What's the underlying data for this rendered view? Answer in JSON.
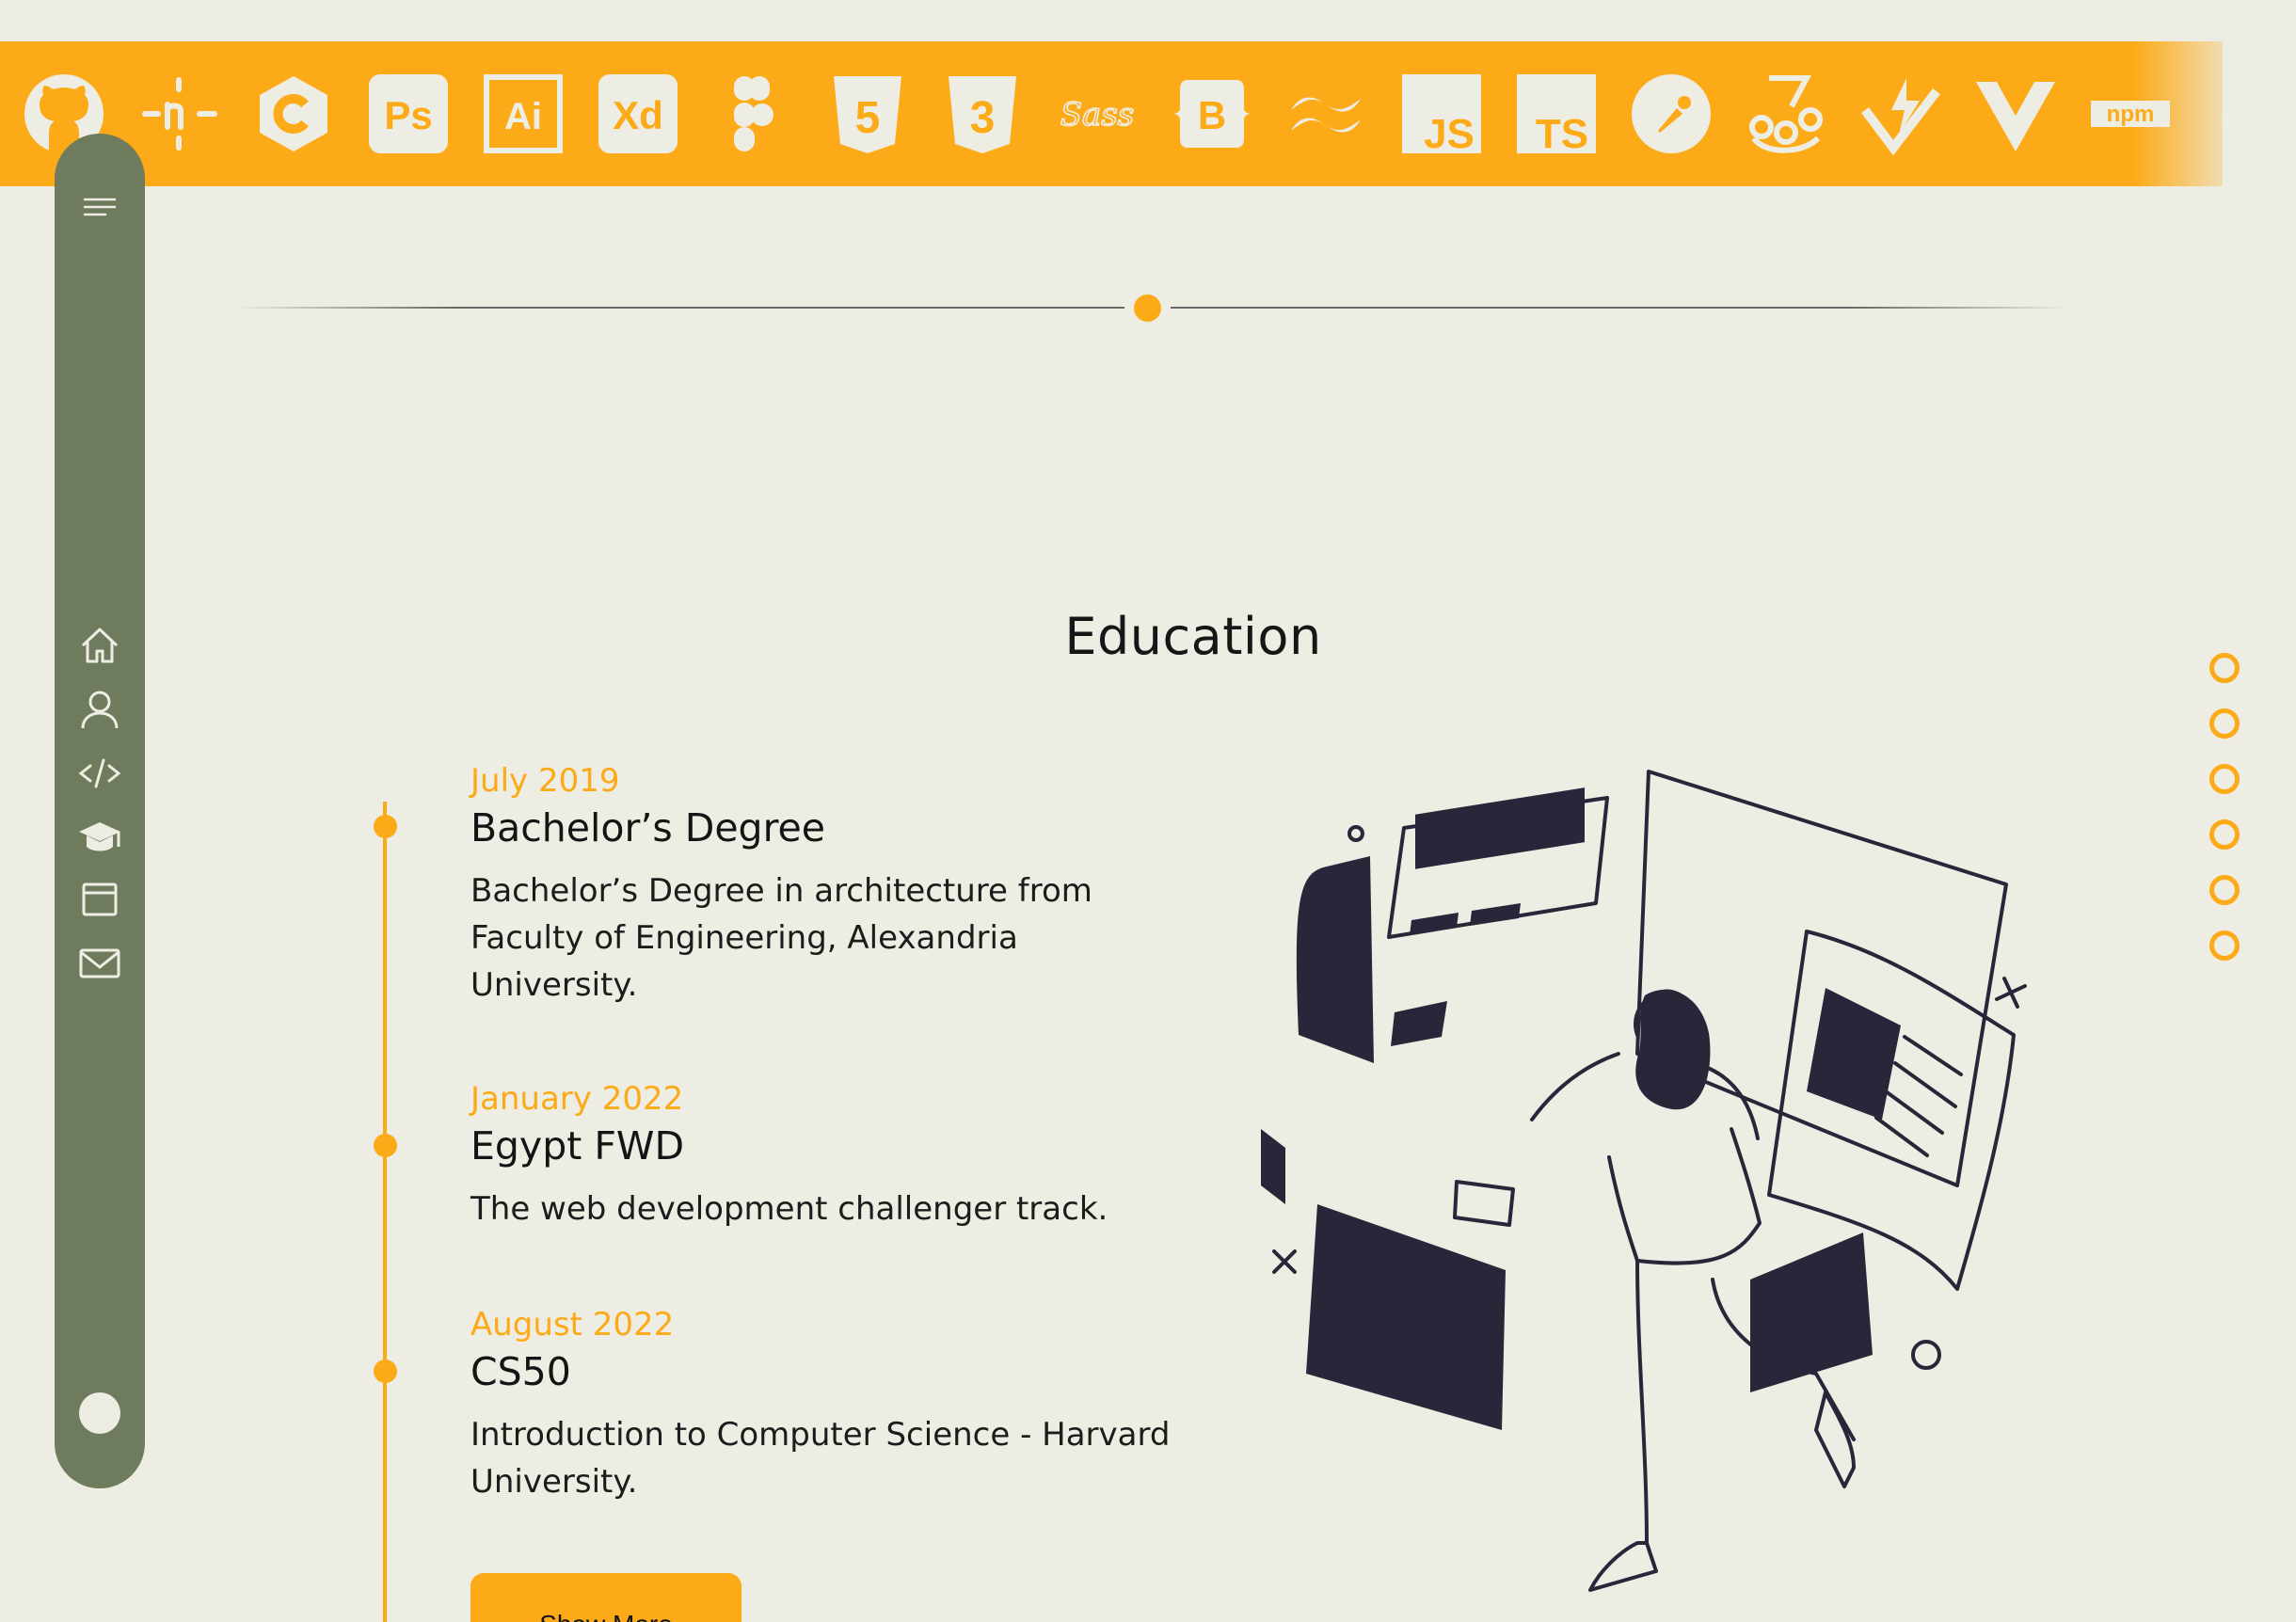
{
  "skills": [
    {
      "name": "github-icon"
    },
    {
      "name": "n8n-icon"
    },
    {
      "name": "c-language-icon"
    },
    {
      "name": "photoshop-icon",
      "label": "Ps"
    },
    {
      "name": "illustrator-icon",
      "label": "Ai"
    },
    {
      "name": "adobe-xd-icon",
      "label": "Xd"
    },
    {
      "name": "figma-icon"
    },
    {
      "name": "html5-icon",
      "label": "5"
    },
    {
      "name": "css3-icon",
      "label": "3"
    },
    {
      "name": "sass-icon",
      "label": "Sass"
    },
    {
      "name": "bootstrap-icon",
      "label": "B"
    },
    {
      "name": "tailwind-icon"
    },
    {
      "name": "javascript-icon",
      "label": "JS"
    },
    {
      "name": "typescript-icon",
      "label": "TS"
    },
    {
      "name": "postman-icon"
    },
    {
      "name": "jest-icon"
    },
    {
      "name": "vitest-icon"
    },
    {
      "name": "vue-icon"
    },
    {
      "name": "npm-icon",
      "label": "npm"
    }
  ],
  "sidebar": {
    "items": [
      {
        "name": "menu-icon"
      },
      {
        "name": "home-icon"
      },
      {
        "name": "about-icon"
      },
      {
        "name": "code-icon"
      },
      {
        "name": "education-icon"
      },
      {
        "name": "projects-icon"
      },
      {
        "name": "mail-icon"
      },
      {
        "name": "theme-toggle-icon"
      }
    ]
  },
  "education": {
    "title": "Education",
    "entries": [
      {
        "date": "July 2019",
        "title": "Bachelor’s Degree",
        "description": "Bachelor’s Degree in architecture from Faculty of Engineering, Alexandria University."
      },
      {
        "date": "January 2022",
        "title": "Egypt FWD",
        "description": "The web development challenger track."
      },
      {
        "date": "August 2022",
        "title": "CS50",
        "description": "Introduction to Computer Science - Harvard University."
      }
    ],
    "show_more_label": "Show More"
  },
  "pager": {
    "count": 6
  },
  "colors": {
    "accent": "#fcaa17",
    "background": "#eeede3",
    "sidebar": "#6f7b5d",
    "illustration_dark": "#2b253a"
  }
}
